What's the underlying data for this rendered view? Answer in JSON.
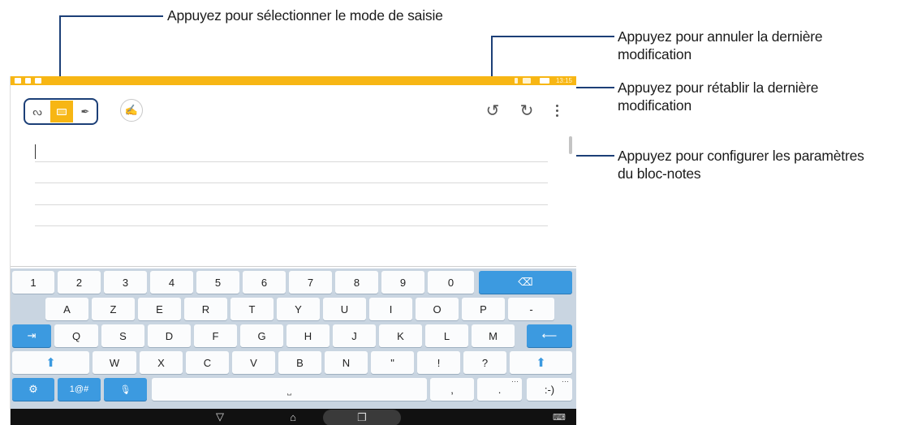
{
  "callouts": {
    "input_mode": "Appuyez pour sélectionner le mode de saisie",
    "undo_line1": "Appuyez pour annuler la dernière",
    "undo_line2": "modification",
    "redo_line1": "Appuyez pour rétablir la dernière",
    "redo_line2": "modification",
    "settings_line1": "Appuyez pour configurer les paramètres",
    "settings_line2": "du bloc-notes"
  },
  "status_bar": {
    "time": "13:15",
    "color": "#f7b614"
  },
  "toolbar": {
    "modes": [
      {
        "name": "handwriting",
        "icon": "handwriting-icon",
        "glyph": "ᔓ"
      },
      {
        "name": "keyboard",
        "icon": "keyboard-icon",
        "selected": true
      },
      {
        "name": "pen",
        "icon": "pen-icon",
        "glyph": "✒"
      }
    ],
    "ink_glyph": "✍",
    "undo_glyph": "↺",
    "redo_glyph": "↻"
  },
  "keyboard": {
    "row_numbers": [
      "1",
      "2",
      "3",
      "4",
      "5",
      "6",
      "7",
      "8",
      "9",
      "0"
    ],
    "backspace_glyph": "⌫",
    "row_letters1": [
      "A",
      "Z",
      "E",
      "R",
      "T",
      "Y",
      "U",
      "I",
      "O",
      "P",
      "-"
    ],
    "tab_glyph": "⇥",
    "row_letters2": [
      "Q",
      "S",
      "D",
      "F",
      "G",
      "H",
      "J",
      "K",
      "L",
      "M"
    ],
    "enter_glyph": "⟵",
    "shift_glyph": "⬆",
    "row_letters3": [
      "W",
      "X",
      "C",
      "V",
      "B",
      "N",
      "\"",
      "!",
      "?"
    ],
    "settings_glyph": "⚙",
    "symbols_label": "1@#",
    "mic_glyph": "🎙",
    "space_glyph": "⎵",
    "comma": ",",
    "period": ".",
    "smiley": ":-)",
    "more_dots": "···",
    "accent_color": "#3c9ae0"
  },
  "navbar": {
    "back_glyph": "▽",
    "home_glyph": "⌂",
    "recents_glyph": "❐",
    "keyboard_glyph": "⌨"
  }
}
